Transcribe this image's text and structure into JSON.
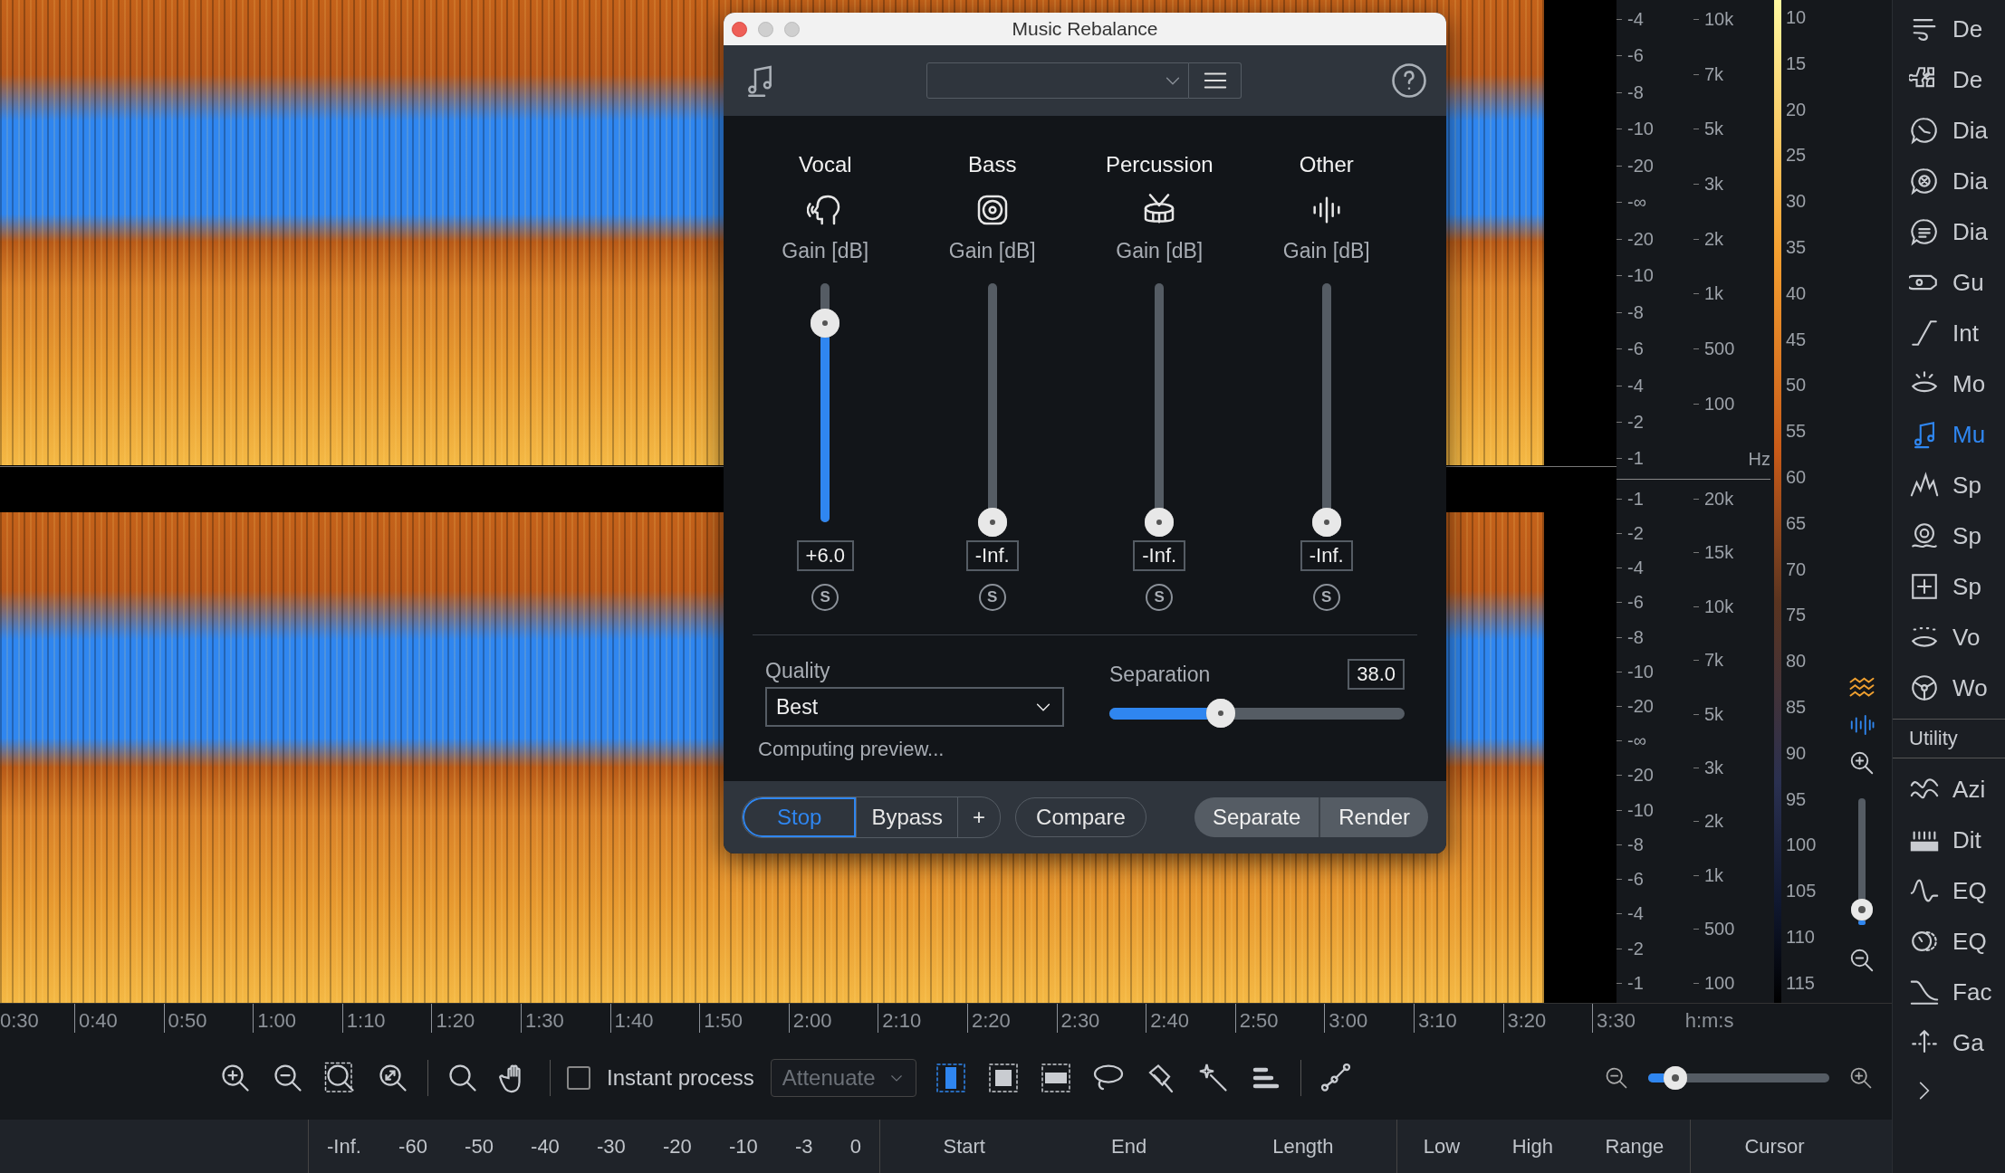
{
  "db_scale": {
    "channels": [
      {
        "ticks": [
          "-4",
          "-6",
          "-8",
          "-10",
          "-20",
          "-∞",
          "-20",
          "-10",
          "-8",
          "-6",
          "-4",
          "-2",
          "-1"
        ]
      },
      {
        "ticks": [
          "-1",
          "-2",
          "-4",
          "-6",
          "-8",
          "-10",
          "-20",
          "-∞",
          "-20",
          "-10",
          "-8",
          "-6",
          "-4",
          "-2",
          "-1"
        ]
      }
    ]
  },
  "hz_scale": {
    "unit": "Hz",
    "channels": [
      {
        "ticks": [
          "10k",
          "7k",
          "5k",
          "3k",
          "2k",
          "1k",
          "500",
          "100"
        ]
      },
      {
        "ticks": [
          "20k",
          "15k",
          "10k",
          "7k",
          "5k",
          "3k",
          "2k",
          "1k",
          "500",
          "100"
        ]
      }
    ]
  },
  "amplitude_scale": [
    "10",
    "15",
    "20",
    "25",
    "30",
    "35",
    "40",
    "45",
    "50",
    "55",
    "60",
    "65",
    "70",
    "75",
    "80",
    "85",
    "90",
    "95",
    "100",
    "105",
    "110",
    "115"
  ],
  "view_zoom": {
    "level": 0.12
  },
  "time_ruler": {
    "unit": "h:m:s",
    "ticks": [
      "0:30",
      "0:40",
      "0:50",
      "1:00",
      "1:10",
      "1:20",
      "1:30",
      "1:40",
      "1:50",
      "2:00",
      "2:10",
      "2:20",
      "2:30",
      "2:40",
      "2:50",
      "3:00",
      "3:10",
      "3:20",
      "3:30"
    ]
  },
  "toolbar": {
    "tools": [
      {
        "kind": "zoom-in"
      },
      {
        "kind": "zoom-out"
      },
      {
        "kind": "zoom-selection"
      },
      {
        "kind": "zoom-fit"
      },
      {
        "kind": "magnify"
      },
      {
        "kind": "hand"
      }
    ],
    "instant_process": {
      "label": "Instant process",
      "checked": false
    },
    "mode": {
      "value": "Attenuate",
      "disabled": true
    },
    "selection_tools": [
      {
        "kind": "time",
        "selected": true
      },
      {
        "kind": "time-frequency",
        "selected": false
      },
      {
        "kind": "frequency",
        "selected": false
      },
      {
        "kind": "lasso",
        "selected": false
      },
      {
        "kind": "brush",
        "selected": false
      },
      {
        "kind": "wand",
        "selected": false
      },
      {
        "kind": "harmonic",
        "selected": false
      },
      {
        "kind": "envelope",
        "selected": false
      }
    ],
    "zoom": {
      "level": 0.15
    }
  },
  "meter_scale": [
    "-Inf.",
    "-60",
    "-50",
    "-40",
    "-30",
    "-20",
    "-10",
    "-3",
    "0"
  ],
  "info_columns": [
    [
      "Start",
      "End",
      "Length"
    ],
    [
      "Low",
      "High",
      "Range"
    ],
    [
      "Cursor"
    ]
  ],
  "sidebar": {
    "items": [
      {
        "label": "De",
        "selected": false
      },
      {
        "label": "De",
        "selected": false
      },
      {
        "label": "Dia",
        "selected": false
      },
      {
        "label": "Dia",
        "selected": false
      },
      {
        "label": "Dia",
        "selected": false
      },
      {
        "label": "Gu",
        "selected": false
      },
      {
        "label": "Int",
        "selected": false
      },
      {
        "label": "Mo",
        "selected": false
      },
      {
        "label": "Mu",
        "selected": true
      },
      {
        "label": "Sp",
        "selected": false
      },
      {
        "label": "Sp",
        "selected": false
      },
      {
        "label": "Sp",
        "selected": false
      },
      {
        "label": "Vo",
        "selected": false
      },
      {
        "label": "Wo",
        "selected": false
      }
    ],
    "section": "Utility",
    "utility_items": [
      {
        "label": "Azi",
        "selected": false
      },
      {
        "label": "Dit",
        "selected": false
      },
      {
        "label": "EQ",
        "selected": false
      },
      {
        "label": "EQ",
        "selected": false
      },
      {
        "label": "Fac",
        "selected": false
      },
      {
        "label": "Ga",
        "selected": false
      }
    ]
  },
  "dialog": {
    "title": "Music Rebalance",
    "stems": [
      {
        "kind": "vocal",
        "name": "Vocal",
        "gain_label": "Gain [dB]",
        "level": 0.835,
        "value": "+6.0",
        "solo": "S"
      },
      {
        "kind": "bass",
        "name": "Bass",
        "gain_label": "Gain [dB]",
        "level": 0,
        "value": "-Inf.",
        "solo": "S"
      },
      {
        "kind": "percussion",
        "name": "Percussion",
        "gain_label": "Gain [dB]",
        "level": 0,
        "value": "-Inf.",
        "solo": "S"
      },
      {
        "kind": "other",
        "name": "Other",
        "gain_label": "Gain [dB]",
        "level": 0,
        "value": "-Inf.",
        "solo": "S"
      }
    ],
    "quality": {
      "label": "Quality",
      "value": "Best"
    },
    "separation": {
      "label": "Separation",
      "value": "38.0",
      "level": 0.377
    },
    "status": "Computing preview...",
    "transport": [
      {
        "label": "Stop",
        "selected": true
      },
      {
        "label": "Bypass",
        "selected": false
      },
      {
        "label": "+",
        "selected": false
      }
    ],
    "compare": "Compare",
    "actions": [
      "Separate",
      "Render"
    ]
  }
}
